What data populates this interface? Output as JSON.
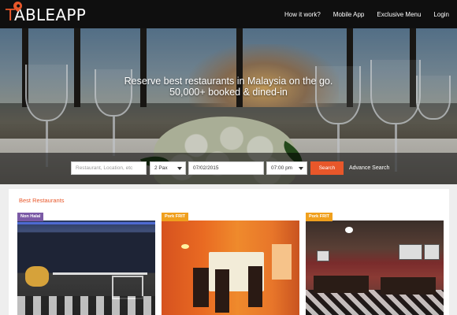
{
  "app": {
    "logo_first": "T",
    "logo_rest": "ABLEAPP"
  },
  "nav": {
    "items": [
      "How it work?",
      "Mobile App",
      "Exclusive Menu",
      "Login"
    ]
  },
  "hero": {
    "line1": "Reserve best restaurants in Malaysia on the go.",
    "line2": "50,000+ booked & dined-in"
  },
  "search": {
    "placeholder": "Restaurant, Location, etc",
    "pax": "2 Pax",
    "date": "07/02/2015",
    "time": "07:00 pm",
    "button": "Search",
    "advanced": "Advance Search"
  },
  "section": {
    "title": "Best Restaurants"
  },
  "cards": [
    {
      "badge": "Non Halal",
      "badge_color": "#7b5aa6"
    },
    {
      "badge": "Pork FRIT",
      "badge_color": "#f0a01e"
    },
    {
      "badge": "Pork FRIT",
      "badge_color": "#f0a01e"
    }
  ],
  "colors": {
    "accent": "#e8572a",
    "navbar": "#0f0f0f"
  }
}
